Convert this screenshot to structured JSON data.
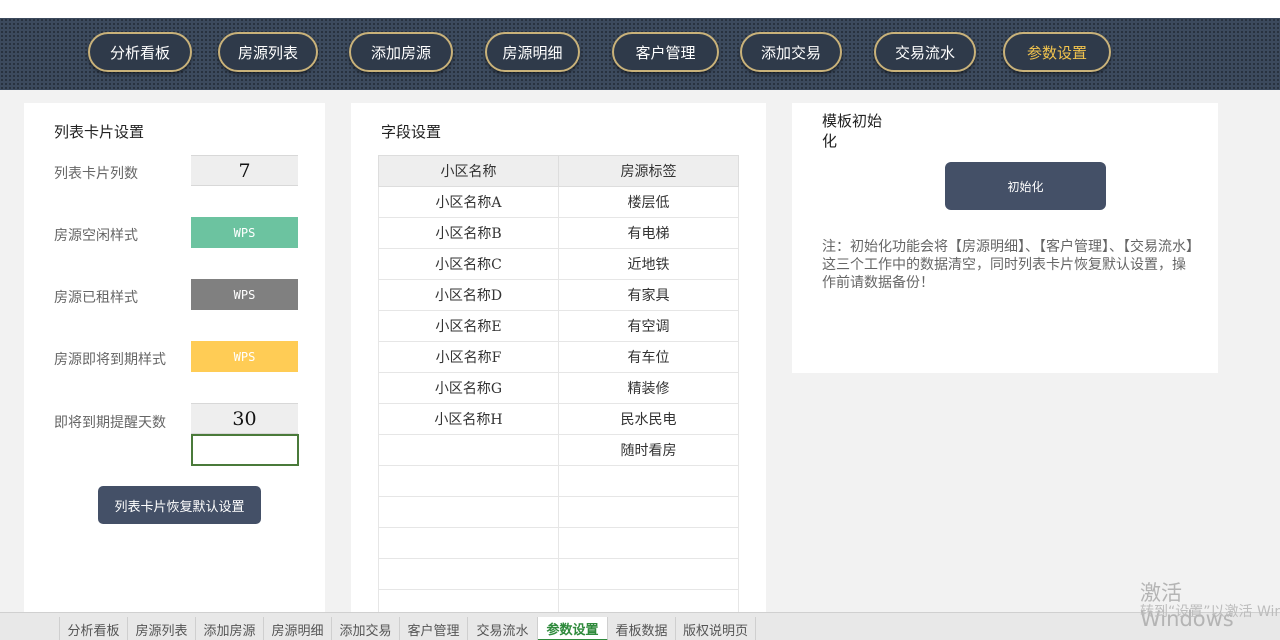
{
  "nav": {
    "buttons": [
      "分析看板",
      "房源列表",
      "添加房源",
      "房源明细",
      "客户管理",
      "添加交易",
      "交易流水",
      "参数设置"
    ],
    "active_index": 7,
    "active_color": "#f2c44e"
  },
  "card_settings": {
    "title": "列表卡片设置",
    "rows": [
      {
        "label": "列表卡片列数",
        "value": "7"
      },
      {
        "label": "房源空闲样式",
        "value": "WPS",
        "color": "#6cc3a0"
      },
      {
        "label": "房源已租样式",
        "value": "WPS",
        "color": "#808080"
      },
      {
        "label": "房源即将到期样式",
        "value": "WPS",
        "color": "#ffcc55"
      },
      {
        "label": "即将到期提醒天数",
        "value": "30"
      }
    ],
    "reset_button": "列表卡片恢复默认设置"
  },
  "field_settings": {
    "title": "字段设置",
    "columns": [
      "小区名称",
      "房源标签"
    ],
    "rows": [
      [
        "小区名称A",
        "楼层低"
      ],
      [
        "小区名称B",
        "有电梯"
      ],
      [
        "小区名称C",
        "近地铁"
      ],
      [
        "小区名称D",
        "有家具"
      ],
      [
        "小区名称E",
        "有空调"
      ],
      [
        "小区名称F",
        "有车位"
      ],
      [
        "小区名称G",
        "精装修"
      ],
      [
        "小区名称H",
        "民水民电"
      ],
      [
        "",
        "随时看房"
      ],
      [
        "",
        ""
      ],
      [
        "",
        ""
      ],
      [
        "",
        ""
      ],
      [
        "",
        ""
      ],
      [
        "",
        ""
      ]
    ]
  },
  "template_init": {
    "title": "模板初始化",
    "button": "初始化",
    "note": "注：初始化功能会将【房源明细】、【客户管理】、【交易流水】这三个工作中的数据清空，同时列表卡片恢复默认设置，操作前请数据备份！"
  },
  "sheet_tabs": {
    "tabs": [
      "",
      "分析看板",
      "房源列表",
      "添加房源",
      "房源明细",
      "添加交易",
      "客户管理",
      "交易流水",
      "参数设置",
      "看板数据",
      "版权说明页"
    ],
    "active_index": 8
  },
  "watermark": {
    "line1": "激活 Windows",
    "line2": "转到“设置”以激活 Windows。"
  }
}
